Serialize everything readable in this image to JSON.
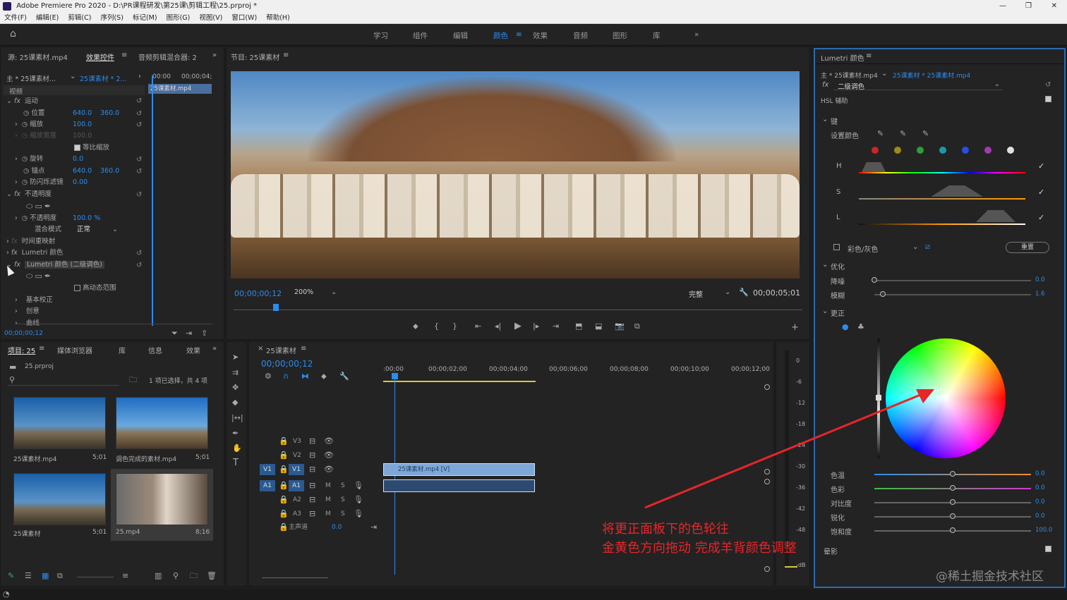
{
  "titlebar": {
    "title": "Adobe Premiere Pro 2020 - D:\\PR课程研发\\第25课\\剪辑工程\\25.prproj *"
  },
  "menu": [
    "文件(F)",
    "编辑(E)",
    "剪辑(C)",
    "序列(S)",
    "标记(M)",
    "图形(G)",
    "视图(V)",
    "窗口(W)",
    "帮助(H)"
  ],
  "workspaces": [
    "学习",
    "组件",
    "编辑",
    "颜色",
    "效果",
    "音频",
    "图形",
    "库"
  ],
  "left_panel": {
    "tabs": [
      "源: 25课素材.mp4",
      "效果控件",
      "音频剪辑混合器: 2"
    ],
    "source_label": "主 * 25课素材...",
    "clip_label": "25课素材 * 2...",
    "time_start": "00:00",
    "time_end": "00;00;04;",
    "clip_bar": "25课素材.mp4",
    "video_label": "视频",
    "rows": [
      {
        "label": "运动"
      },
      {
        "label": "位置",
        "v1": "640.0",
        "v2": "360.0"
      },
      {
        "label": "缩放",
        "v1": "100.0"
      },
      {
        "label": "缩放宽度",
        "v1": "100.0"
      },
      {
        "label": "等比缩放"
      },
      {
        "label": "旋转",
        "v1": "0.0"
      },
      {
        "label": "锚点",
        "v1": "640.0",
        "v2": "360.0"
      },
      {
        "label": "防闪烁滤镜",
        "v1": "0.00"
      },
      {
        "label": "不透明度"
      },
      {
        "label": "不透明度",
        "v1": "100.0 %"
      },
      {
        "label": "混合模式",
        "v1": "正常"
      },
      {
        "label": "时间重映射"
      },
      {
        "label": "Lumetri 颜色"
      },
      {
        "label": "Lumetri 颜色 (二级调色)"
      },
      {
        "label": "高动态范围"
      },
      {
        "label": "基本校正"
      },
      {
        "label": "创意"
      },
      {
        "label": "曲线"
      }
    ],
    "timecode": "00;00;00;12"
  },
  "program": {
    "title": "节目: 25课素材",
    "timecode": "00;00;00;12",
    "zoom": "200%",
    "quality": "完整",
    "duration": "00;00;05;01"
  },
  "project": {
    "tabs": [
      "项目: 25",
      "媒体浏览器",
      "库",
      "信息",
      "效果"
    ],
    "filename": "25.prproj",
    "selection": "1 项已选择，共 4 项",
    "items": [
      {
        "name": "25课素材.mp4",
        "dur": "5;01"
      },
      {
        "name": "调色完成的素材.mp4",
        "dur": "5;01"
      },
      {
        "name": "25课素材",
        "dur": "5;01"
      },
      {
        "name": "25.mp4",
        "dur": "8;16"
      }
    ]
  },
  "timeline": {
    "title": "25课素材",
    "timecode": "00;00;00;12",
    "ruler": [
      ":00;00",
      "00;00;02;00",
      "00;00;04;00",
      "00;00;06;00",
      "00;00;08;00",
      "00;00;10;00",
      "00;00;12;00"
    ],
    "tracks": [
      "V3",
      "V2",
      "V1",
      "A1",
      "A2",
      "A3"
    ],
    "master": "主声道",
    "master_val": "0.0",
    "clip_v": "25课素材.mp4 [V]",
    "meter_ticks": [
      "0",
      "-6",
      "-12",
      "-18",
      "-24",
      "-30",
      "-36",
      "-42",
      "-48",
      "-dB"
    ]
  },
  "lumetri": {
    "title": "Lumetri 颜色",
    "master": "主 * 25课素材.mp4",
    "clip": "25课素材 * 25课素材.mp4",
    "preset": "二级调色",
    "section": "HSL 辅助",
    "key": "键",
    "set_color": "设置颜色",
    "hsl": [
      "H",
      "S",
      "L"
    ],
    "color_gray": "彩色/灰色",
    "reset_btn": "重置",
    "refine": "优化",
    "denoise": "降噪",
    "denoise_val": "0.0",
    "blur": "模糊",
    "blur_val": "1.6",
    "correct": "更正",
    "adjustments": [
      {
        "label": "色温",
        "val": "0.0"
      },
      {
        "label": "色彩",
        "val": "0.0"
      },
      {
        "label": "对比度",
        "val": "0.0"
      },
      {
        "label": "锐化",
        "val": "0.0"
      },
      {
        "label": "饱和度",
        "val": "100.0"
      }
    ],
    "vignette": "晕影",
    "swatches": [
      "#c62828",
      "#9e8a18",
      "#2e9e3a",
      "#1a9aa8",
      "#2a4ee0",
      "#a03ab0",
      "#e0e0e0"
    ]
  },
  "annotation": {
    "line1": "将更正面板下的色轮往",
    "line2": "金黄色方向拖动 完成羊背颜色调整"
  },
  "watermark": "@稀土掘金技术社区"
}
